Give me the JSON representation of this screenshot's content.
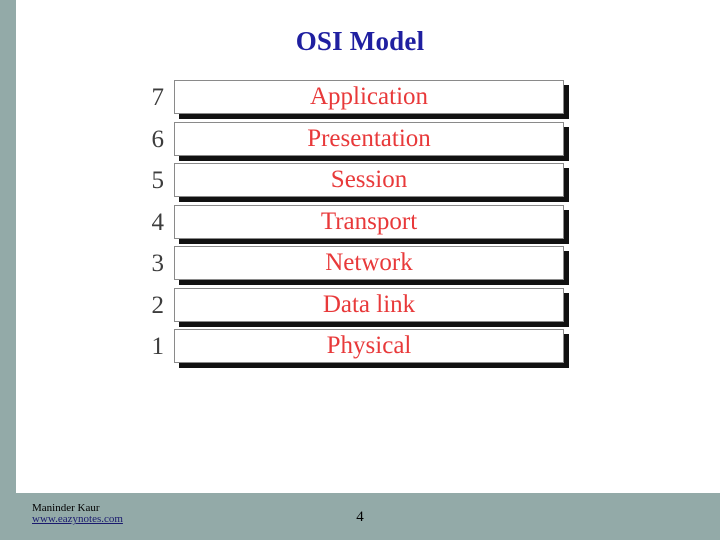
{
  "slide": {
    "title": "OSI Model",
    "title_color": "#1f1fa0",
    "background_color": "#ffffff",
    "band_color": "#93aaa8",
    "slide_number": "4"
  },
  "footer": {
    "author": "Maninder Kaur",
    "url": "www.eazynotes.com"
  },
  "diagram": {
    "type": "stacked-layers",
    "label_color": "#e8393a",
    "number_color": "#3d3d3d",
    "layers": [
      {
        "number": "7",
        "label": "Application"
      },
      {
        "number": "6",
        "label": "Presentation"
      },
      {
        "number": "5",
        "label": "Session"
      },
      {
        "number": "4",
        "label": "Transport"
      },
      {
        "number": "3",
        "label": "Network"
      },
      {
        "number": "2",
        "label": "Data link"
      },
      {
        "number": "1",
        "label": "Physical"
      }
    ]
  }
}
